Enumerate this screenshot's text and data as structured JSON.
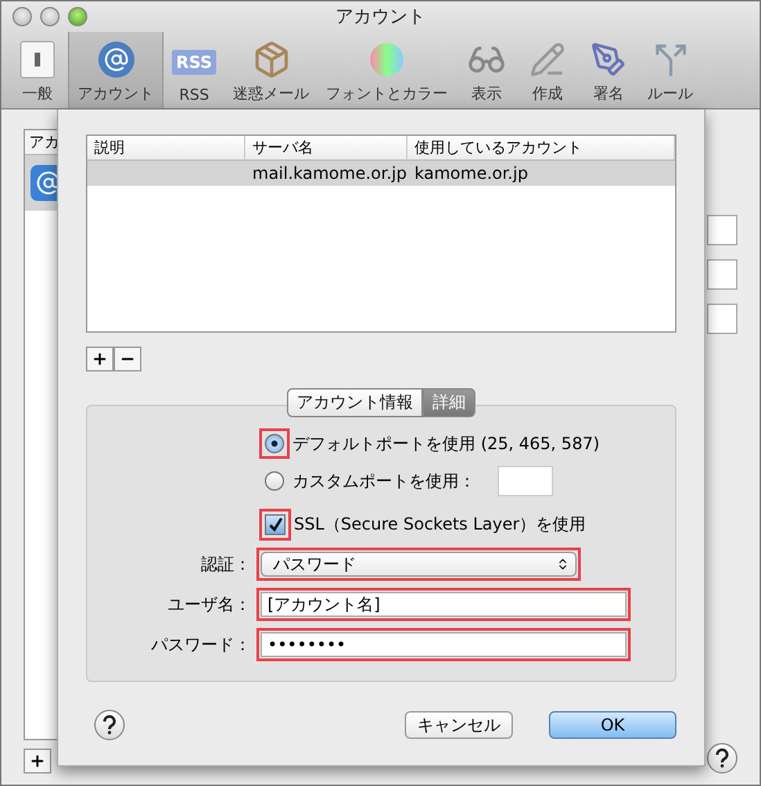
{
  "window": {
    "title": "アカウント"
  },
  "toolbar": {
    "items": [
      {
        "label": "一般",
        "selected": false
      },
      {
        "label": "アカウント",
        "selected": true
      },
      {
        "label": "RSS",
        "selected": false,
        "badge": "RSS"
      },
      {
        "label": "迷惑メール",
        "selected": false
      },
      {
        "label": "フォントとカラー",
        "selected": false
      },
      {
        "label": "表示",
        "selected": false
      },
      {
        "label": "作成",
        "selected": false
      },
      {
        "label": "署名",
        "selected": false
      },
      {
        "label": "ルール",
        "selected": false
      }
    ]
  },
  "background": {
    "sidebar_header": "アカ"
  },
  "sheet": {
    "table": {
      "columns": [
        "説明",
        "サーバ名",
        "使用しているアカウント"
      ],
      "rows": [
        {
          "cells": [
            "",
            "mail.kamome.or.jp",
            "kamome.or.jp"
          ],
          "selected": true
        }
      ]
    },
    "tabs": [
      {
        "label": "アカウント情報",
        "selected": false
      },
      {
        "label": "詳細",
        "selected": true
      }
    ],
    "port_options": [
      {
        "label": "デフォルトポートを使用 (25, 465, 587)",
        "selected": true,
        "highlighted": true
      },
      {
        "label": "カスタムポートを使用：",
        "selected": false,
        "highlighted": false
      }
    ],
    "ssl": {
      "label": "SSL（Secure Sockets Layer）を使用",
      "checked": true,
      "highlighted": true
    },
    "fields": [
      {
        "kind": "select",
        "label": "認証：",
        "value": "パスワード",
        "highlighted": true
      },
      {
        "kind": "text",
        "label": "ユーザ名：",
        "value": "[アカウント名]",
        "highlighted": true
      },
      {
        "kind": "password",
        "label": "パスワード：",
        "value": "••••••••",
        "highlighted": true
      }
    ],
    "buttons": [
      {
        "label": "キャンセル",
        "default": false
      },
      {
        "label": "OK",
        "default": true
      }
    ]
  }
}
